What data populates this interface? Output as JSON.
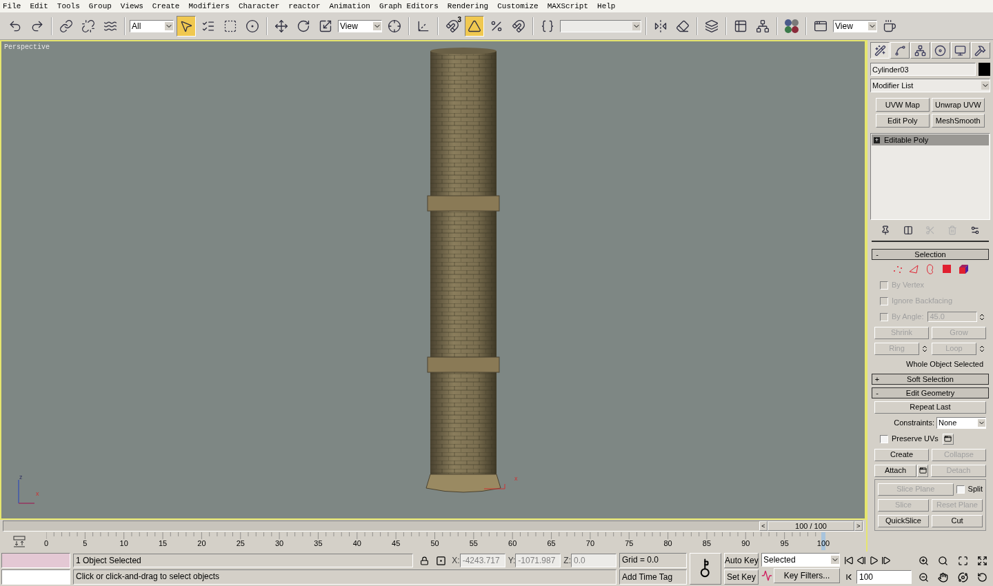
{
  "menu": [
    "File",
    "Edit",
    "Tools",
    "Group",
    "Views",
    "Create",
    "Modifiers",
    "Character",
    "reactor",
    "Animation",
    "Graph Editors",
    "Rendering",
    "Customize",
    "MAXScript",
    "Help"
  ],
  "toolbar": [
    {
      "kind": "button",
      "selected": false
    },
    {
      "kind": "button",
      "selected": false
    },
    {
      "kind": "separator"
    },
    {
      "kind": "button",
      "selected": false
    },
    {
      "kind": "button",
      "selected": false
    },
    {
      "kind": "button",
      "selected": false
    },
    {
      "kind": "separator"
    },
    {
      "kind": "dropdown",
      "value": "All"
    },
    {
      "kind": "button",
      "selected": true
    },
    {
      "kind": "button",
      "selected": false
    },
    {
      "kind": "button",
      "selected": false
    },
    {
      "kind": "button",
      "selected": false
    },
    {
      "kind": "separator"
    },
    {
      "kind": "button",
      "selected": false
    },
    {
      "kind": "button",
      "selected": false
    },
    {
      "kind": "button",
      "selected": false
    },
    {
      "kind": "dropdown",
      "value": "View"
    },
    {
      "kind": "button",
      "selected": false
    },
    {
      "kind": "separator"
    },
    {
      "kind": "button",
      "selected": false
    },
    {
      "kind": "separator"
    },
    {
      "kind": "button",
      "selected": false,
      "badge": "3"
    },
    {
      "kind": "button",
      "selected": true
    },
    {
      "kind": "button",
      "selected": false
    },
    {
      "kind": "button",
      "selected": false
    },
    {
      "kind": "separator"
    },
    {
      "kind": "button",
      "selected": false
    },
    {
      "kind": "named_selection_field"
    },
    {
      "kind": "separator"
    },
    {
      "kind": "button",
      "selected": false
    },
    {
      "kind": "button",
      "selected": false
    },
    {
      "kind": "separator"
    },
    {
      "kind": "button",
      "selected": false
    },
    {
      "kind": "separator"
    },
    {
      "kind": "button",
      "selected": false
    },
    {
      "kind": "button",
      "selected": false
    },
    {
      "kind": "separator"
    },
    {
      "kind": "button",
      "selected": false
    },
    {
      "kind": "separator"
    },
    {
      "kind": "button",
      "selected": false
    },
    {
      "kind": "dropdown",
      "value": "View"
    },
    {
      "kind": "button",
      "selected": false
    }
  ],
  "viewport": {
    "label": "Perspective",
    "axis_z": "z",
    "axis_x": "x",
    "gizmo_x": "x"
  },
  "time_slider": {
    "label": "100 / 100",
    "level": 1,
    "prev": "<",
    "next": ">"
  },
  "track_bar": {
    "ticks": [
      "0",
      "5",
      "10",
      "15",
      "20",
      "25",
      "30",
      "35",
      "40",
      "45",
      "50",
      "55",
      "60",
      "65",
      "70",
      "75",
      "80",
      "85",
      "90",
      "95",
      "100"
    ]
  },
  "command_panel": {
    "tabs": [
      {
        "selected": true
      },
      {
        "selected": false
      },
      {
        "selected": false
      },
      {
        "selected": false
      },
      {
        "selected": false
      },
      {
        "selected": false
      }
    ],
    "object_name": "Cylinder03",
    "modifier_list": "Modifier List",
    "modifier_buttons": [
      "UVW Map",
      "Unwrap UVW",
      "Edit Poly",
      "MeshSmooth"
    ],
    "stack": [
      {
        "toggle": "+",
        "label": "Editable Poly",
        "selected": true
      }
    ],
    "stack_tools": [
      {
        "disabled": false
      },
      {
        "disabled": false
      },
      {
        "disabled": true
      },
      {
        "disabled": true
      },
      {
        "disabled": false
      }
    ],
    "rollouts": [
      {
        "toggle": "-",
        "title": "Selection",
        "rows": [
          [
            {
              "kind": "subobject",
              "selected": false
            },
            {
              "kind": "subobject",
              "selected": false
            },
            {
              "kind": "subobject",
              "selected": false
            },
            {
              "kind": "subobject",
              "selected": false
            },
            {
              "kind": "subobject",
              "selected": false
            }
          ],
          [
            {
              "kind": "checkbox",
              "label": "By Vertex",
              "checked": false,
              "disabled": true
            }
          ],
          [
            {
              "kind": "checkbox",
              "label": "Ignore Backfacing",
              "checked": false,
              "disabled": true
            }
          ],
          [
            {
              "kind": "checkbox",
              "label": "By Angle:",
              "checked": false,
              "disabled": true
            },
            {
              "kind": "spinner",
              "value": "45.0",
              "disabled": true
            }
          ],
          [
            {
              "kind": "button",
              "label": "Shrink",
              "disabled": true
            },
            {
              "kind": "button",
              "label": "Grow",
              "disabled": true
            }
          ],
          [
            {
              "kind": "spinner_button",
              "label": "Ring",
              "disabled": true
            },
            {
              "kind": "spinner_button",
              "label": "Loop",
              "disabled": true
            }
          ],
          [
            {
              "kind": "text",
              "label": "Whole Object Selected"
            }
          ]
        ]
      },
      {
        "toggle": "+",
        "title": "Soft Selection"
      },
      {
        "toggle": "-",
        "title": "Edit Geometry",
        "rows": [
          [
            {
              "kind": "button",
              "label": "Repeat Last",
              "disabled": false
            }
          ],
          [
            {
              "kind": "text",
              "label": "Constraints:"
            },
            {
              "kind": "dropdown",
              "value": "None"
            }
          ],
          [
            {
              "kind": "checkbox",
              "label": "Preserve UVs",
              "checked": false,
              "disabled": false
            },
            {
              "kind": "settings"
            }
          ],
          [
            {
              "kind": "button",
              "label": "Create",
              "disabled": false
            },
            {
              "kind": "button",
              "label": "Collapse",
              "disabled": true
            }
          ],
          [
            {
              "kind": "settings_button",
              "label": "Attach",
              "disabled": false
            },
            {
              "kind": "button",
              "label": "Detach",
              "disabled": true
            }
          ]
        ],
        "group_rows": [
          [
            {
              "kind": "button",
              "label": "Slice Plane",
              "disabled": true
            },
            {
              "kind": "checkbox",
              "label": "Split",
              "checked": false,
              "disabled": false
            }
          ],
          [
            {
              "kind": "button",
              "label": "Slice",
              "disabled": true
            },
            {
              "kind": "button",
              "label": "Reset Plane",
              "disabled": true
            }
          ],
          [
            {
              "kind": "button",
              "label": "QuickSlice",
              "disabled": false
            },
            {
              "kind": "button",
              "label": "Cut",
              "disabled": false
            }
          ]
        ]
      }
    ]
  },
  "status": {
    "prompt": "1 Object Selected",
    "hint": "Click or click-and-drag to select objects",
    "coords": [
      {
        "label": "X:",
        "value": "-4243.717"
      },
      {
        "label": "Y:",
        "value": "-1071.987"
      },
      {
        "label": "Z:",
        "value": "0.0"
      }
    ],
    "grid": "Grid = 0.0",
    "time_tag": "Add Time Tag",
    "auto_key": "Auto Key",
    "set_key": "Set Key",
    "key_mode": "Selected",
    "key_filters": "Key Filters...",
    "frame": "100"
  }
}
